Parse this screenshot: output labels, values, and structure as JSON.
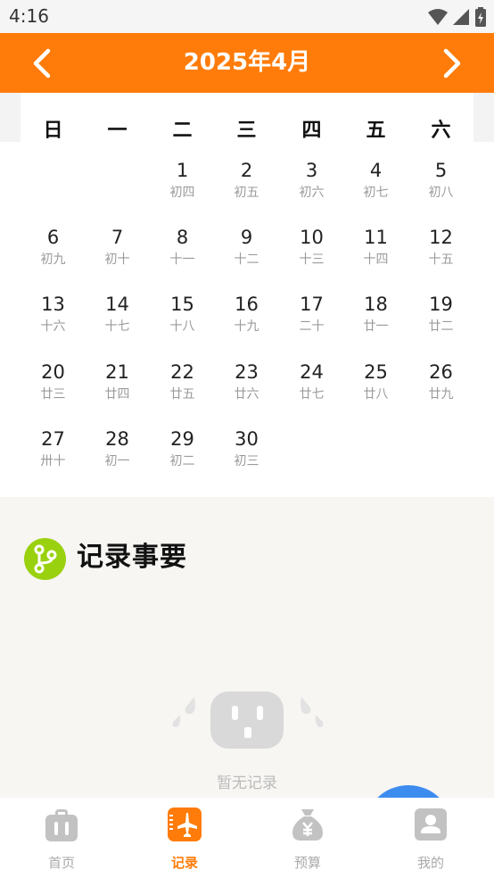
{
  "status_bar": {
    "time": "4:16"
  },
  "header": {
    "title": "2025年4月"
  },
  "calendar": {
    "weekdays": [
      "日",
      "一",
      "二",
      "三",
      "四",
      "五",
      "六"
    ],
    "days": [
      {
        "num": "1",
        "lunar": "初四"
      },
      {
        "num": "2",
        "lunar": "初五"
      },
      {
        "num": "3",
        "lunar": "初六"
      },
      {
        "num": "4",
        "lunar": "初七"
      },
      {
        "num": "5",
        "lunar": "初八"
      },
      {
        "num": "6",
        "lunar": "初九"
      },
      {
        "num": "7",
        "lunar": "初十"
      },
      {
        "num": "8",
        "lunar": "十一"
      },
      {
        "num": "9",
        "lunar": "十二"
      },
      {
        "num": "10",
        "lunar": "十三"
      },
      {
        "num": "11",
        "lunar": "十四"
      },
      {
        "num": "12",
        "lunar": "十五"
      },
      {
        "num": "13",
        "lunar": "十六"
      },
      {
        "num": "14",
        "lunar": "十七"
      },
      {
        "num": "15",
        "lunar": "十八"
      },
      {
        "num": "16",
        "lunar": "十九"
      },
      {
        "num": "17",
        "lunar": "二十"
      },
      {
        "num": "18",
        "lunar": "廿一"
      },
      {
        "num": "19",
        "lunar": "廿二"
      },
      {
        "num": "20",
        "lunar": "廿三"
      },
      {
        "num": "21",
        "lunar": "廿四"
      },
      {
        "num": "22",
        "lunar": "廿五"
      },
      {
        "num": "23",
        "lunar": "廿六"
      },
      {
        "num": "24",
        "lunar": "廿七"
      },
      {
        "num": "25",
        "lunar": "廿八"
      },
      {
        "num": "26",
        "lunar": "廿九"
      },
      {
        "num": "27",
        "lunar": "卅十"
      },
      {
        "num": "28",
        "lunar": "初一"
      },
      {
        "num": "29",
        "lunar": "初二"
      },
      {
        "num": "30",
        "lunar": "初三"
      }
    ]
  },
  "records": {
    "title": "记录事要",
    "empty_text": "暂无记录"
  },
  "bottom_nav": {
    "items": [
      {
        "label": "首页",
        "icon": "luggage-icon"
      },
      {
        "label": "记录",
        "icon": "airplane-icon"
      },
      {
        "label": "预算",
        "icon": "money-bag-icon"
      },
      {
        "label": "我的",
        "icon": "profile-icon"
      }
    ],
    "active_index": 1
  },
  "colors": {
    "accent": "#ff7c0a",
    "records_icon": "#9ad10f",
    "fab": "#3d8cf0"
  }
}
